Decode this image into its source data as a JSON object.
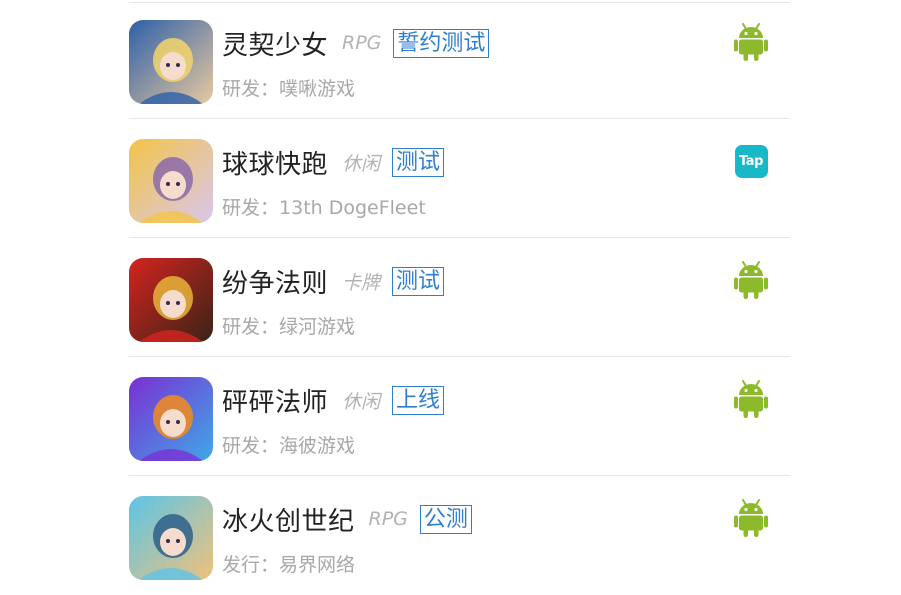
{
  "games": [
    {
      "name": "灵契少女",
      "genre": "RPG",
      "status": "誓约测试",
      "dev_label": "研发：",
      "dev": "噗啾游戏",
      "platform": "android-icon",
      "art": {
        "bg1": "#2d5fa8",
        "bg2": "#e8c9a0",
        "accent": "#f5d56b"
      }
    },
    {
      "name": "球球快跑",
      "genre": "休闲",
      "status": "测试",
      "dev_label": "研发：",
      "dev": "13th DogeFleet",
      "platform": "tap-icon",
      "platform_text": "Tap",
      "art": {
        "bg1": "#f3c447",
        "bg2": "#d9c7ec",
        "accent": "#8a6aa8"
      }
    },
    {
      "name": "纷争法则",
      "genre": "卡牌",
      "status": "测试",
      "dev_label": "研发：",
      "dev": "绿河游戏",
      "platform": "android-icon",
      "art": {
        "bg1": "#d42420",
        "bg2": "#3a2416",
        "accent": "#e8b43a"
      }
    },
    {
      "name": "砰砰法师",
      "genre": "休闲",
      "status": "上线",
      "dev_label": "研发：",
      "dev": "海彼游戏",
      "platform": "android-icon",
      "art": {
        "bg1": "#7a2fd4",
        "bg2": "#3fa8e6",
        "accent": "#f28c1c"
      }
    },
    {
      "name": "冰火创世纪",
      "genre": "RPG",
      "status": "公测",
      "dev_label": "发行：",
      "dev": "易界网络",
      "platform": "android-icon",
      "art": {
        "bg1": "#5cc4e8",
        "bg2": "#f0c27a",
        "accent": "#2f5f8a"
      }
    }
  ],
  "colors": {
    "android": "#8cba2b",
    "tag": "#2e7fd0",
    "tap": "#17b8c8"
  }
}
